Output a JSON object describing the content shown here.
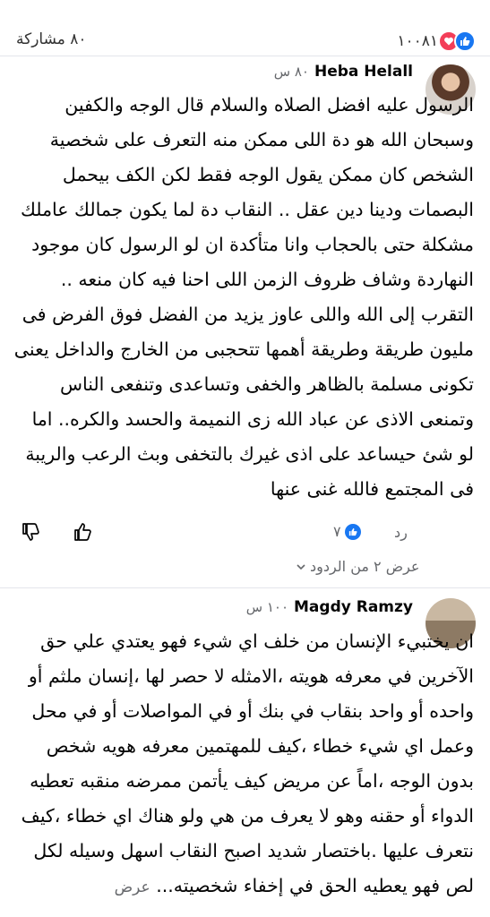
{
  "post_stats": {
    "shares_text": "٨٠ مشاركة",
    "reactions_count": "١٠٠٨١"
  },
  "comments": [
    {
      "name": "Heba Helall",
      "time": "٨٠ س",
      "text": "الرسول عليه افضل الصلاه والسلام قال الوجه والكفين وسبحان الله هو دة اللى ممكن منه التعرف على شخصية الشخص كان ممكن يقول الوجه فقط لكن الكف بيحمل البصمات ودينا دين عقل .. النقاب دة لما يكون جمالك عاملك مشكلة حتى بالحجاب وانا متأكدة ان لو الرسول كان موجود النهاردة وشاف ظروف الزمن اللى احنا فيه كان منعه .. التقرب إلى الله واللى عاوز يزيد من الفضل فوق الفرض فى مليون طريقة وطريقة أهمها تتحجبى من الخارج والداخل يعنى تكونى مسلمة بالظاهر والخفى وتساعدى وتنفعى الناس وتمنعى الاذى عن عباد الله زى النميمة والحسد والكره.. اما لو شئ حيساعد على اذى غيرك بالتخفى وبث الرعب والريبة فى المجتمع فالله غنى عنها",
      "reply_label": "رد",
      "likes": "٧",
      "view_replies": "عرض ٢ من الردود"
    },
    {
      "name": "Magdy Ramzy",
      "time": "١٠٠ س",
      "text": "ان يختبيء الإنسان من خلف اي شيء فهو يعتدي علي حق الآخرين في معرفه هويته ،الامثله لا حصر لها ،إنسان ملثم أو واحده أو واحد بنقاب في بنك أو في المواصلات أو في محل وعمل اي شيء خطاء ،كيف للمهتمين معرفه هويه شخص بدون الوجه ،اماً عن مريض كيف يأتمن ممرضه منقبه تعطيه الدواء أو حقنه وهو لا يعرف من هي ولو هناك اي خطاء ،كيف نتعرف عليها .باختصار شديد اصبح النقاب اسهل وسيله لكل لص فهو يعطيه الحق في إخفاء شخصيته...",
      "see_more": "عرض"
    }
  ],
  "icons": [
    "like-reaction-icon",
    "love-reaction-icon",
    "thumbs-up-icon",
    "thumbs-down-icon",
    "chevron-down-icon"
  ],
  "colors": {
    "accent": "#1877f2",
    "love": "#f33e58",
    "muted": "#65676b"
  }
}
